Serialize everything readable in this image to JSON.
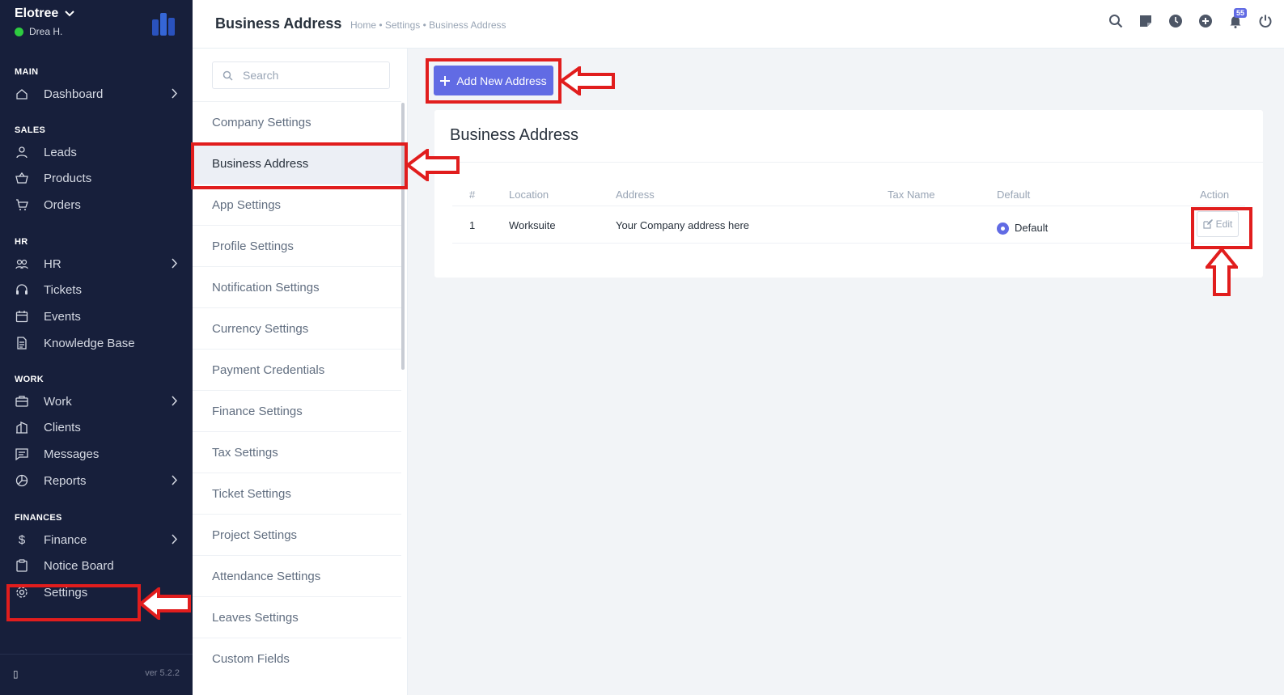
{
  "sidebar": {
    "company": "Elotree",
    "user": "Drea H.",
    "sections": {
      "main": "MAIN",
      "sales": "SALES",
      "hr": "HR",
      "work": "WORK",
      "finances": "FINANCES"
    },
    "items": {
      "dashboard": "Dashboard",
      "leads": "Leads",
      "products": "Products",
      "orders": "Orders",
      "hr": "HR",
      "tickets": "Tickets",
      "events": "Events",
      "knowledge_base": "Knowledge Base",
      "work": "Work",
      "clients": "Clients",
      "messages": "Messages",
      "reports": "Reports",
      "finance": "Finance",
      "notice_board": "Notice Board",
      "settings": "Settings"
    },
    "version": "ver 5.2.2"
  },
  "header": {
    "title": "Business Address",
    "breadcrumb": "Home • Settings • Business Address",
    "notification_count": "55"
  },
  "settings_menu": {
    "search_placeholder": "Search",
    "items": [
      "Company Settings",
      "Business Address",
      "App Settings",
      "Profile Settings",
      "Notification Settings",
      "Currency Settings",
      "Payment Credentials",
      "Finance Settings",
      "Tax Settings",
      "Ticket Settings",
      "Project Settings",
      "Attendance Settings",
      "Leaves Settings",
      "Custom Fields"
    ],
    "active": "Business Address"
  },
  "content": {
    "add_button": "Add New Address",
    "card_title": "Business Address",
    "table": {
      "headers": [
        "#",
        "Location",
        "Address",
        "Tax Name",
        "Default",
        "Action"
      ],
      "rows": [
        {
          "num": "1",
          "location": "Worksuite",
          "address": "Your Company address here",
          "tax_name": "",
          "default": "Default",
          "action": "Edit"
        }
      ]
    }
  },
  "colors": {
    "sidebar_bg": "#171f3b",
    "accent": "#616be4",
    "annotation": "#e11d1d",
    "online": "#2ecc40"
  }
}
